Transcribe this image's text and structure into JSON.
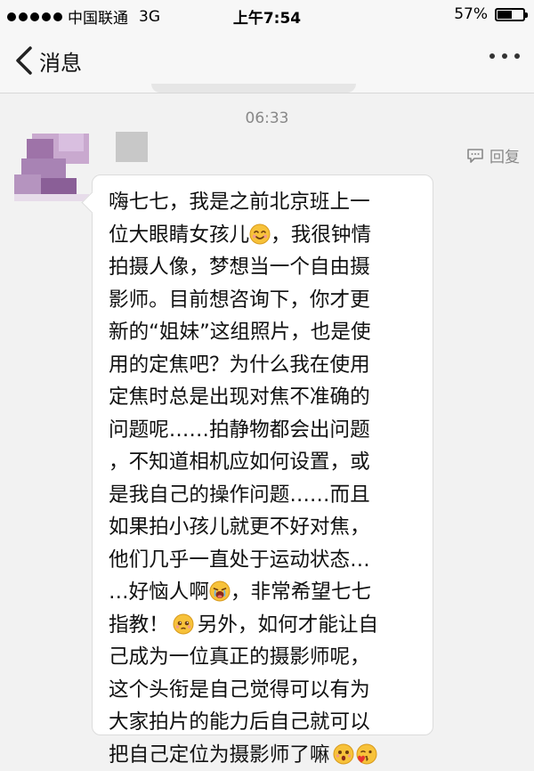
{
  "status": {
    "carrier": "中国联通",
    "network": "3G",
    "time": "上午7:54",
    "battery_percent": "57%",
    "battery_level": 0.57
  },
  "nav": {
    "back_label": "消息"
  },
  "chat": {
    "timestamp": "06:33",
    "reply_label": "回复",
    "message": {
      "part1": "嗨七七，我是之前北京班上一\n位大眼睛女孩儿",
      "part2": "，我很钟情\n拍摄人像，梦想当一个自由摄\n影师。目前想咨询下，你才更\n新的“姐妹”这组照片，也是使\n用的定焦吧？为什么我在使用\n定焦时总是出现对焦不准确的\n问题呢……拍静物都会出问题\n，不知道相机应如何设置，或\n是我自己的操作问题……而且\n如果拍小孩儿就更不好对焦，\n他们几乎一直处于运动状态…\n…好恼人啊",
      "part3": "，非常希望七七\n指教！",
      "part4": "另外，如何才能让自\n己成为一位真正的摄影师呢，\n这个头衔是自己觉得可以有为\n大家拍片的能力后自己就可以\n把自己定位为摄影师了嘛"
    }
  },
  "colors": {
    "background": "#f2f2f2",
    "bubble": "#ffffff",
    "emoji_yellow": "#f7c23a"
  }
}
